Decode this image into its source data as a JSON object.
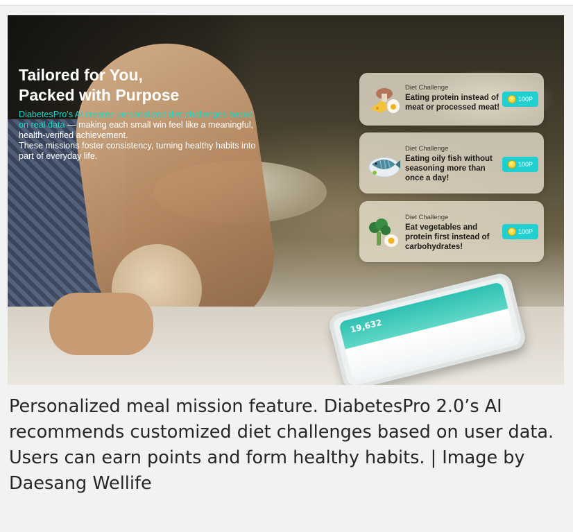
{
  "banner": {
    "headline_line1": "Tailored for You,",
    "headline_line2": "Packed with Purpose",
    "desc_accent": "DiabetesPro's AI creates personalized diet challenges based on real data",
    "desc_rest": " — making each small win feel like a meaningful, health-verified achievement.",
    "desc_line2": "These missions foster consistency, turning healthy habits into part of everyday life."
  },
  "challenges": [
    {
      "kicker": "Diet Challenge",
      "title": "Eating protein instead of meat or processed meat!",
      "points": "100P",
      "icon": "protein-foods-icon"
    },
    {
      "kicker": "Diet Challenge",
      "title": "Eating oily fish without seasoning more than once a day!",
      "points": "100P",
      "icon": "fish-plate-icon"
    },
    {
      "kicker": "Diet Challenge",
      "title": "Eat vegetables and protein first instead of carbohydrates!",
      "points": "100P",
      "icon": "broccoli-egg-icon"
    }
  ],
  "phone_screen": {
    "number": "19,632"
  },
  "caption": "Personalized meal mission feature. DiabetesPro 2.0’s AI recommends customized diet challenges based on user data. Users can earn points and form healthy habits. | Image by Daesang Wellife",
  "colors": {
    "accent": "#1fd6c6",
    "points_badge": "#21cfd0",
    "caption_text": "#262626",
    "page_bg": "#f2f2f2"
  }
}
